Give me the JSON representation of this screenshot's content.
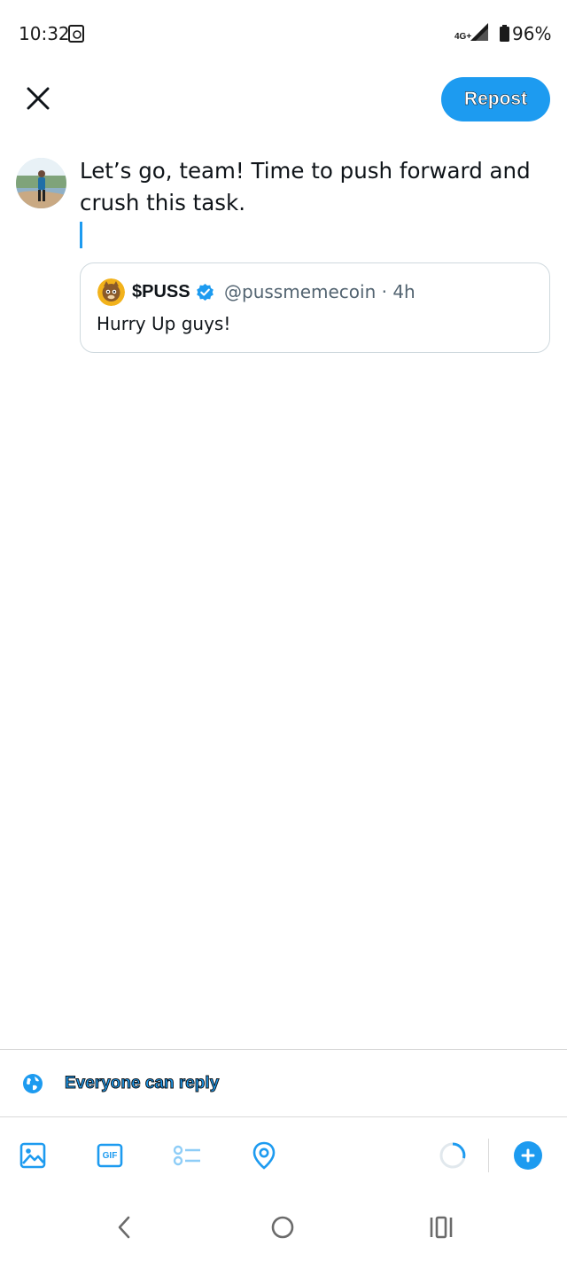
{
  "status_bar": {
    "time": "10:32",
    "network": "4G+",
    "battery": "96%"
  },
  "header": {
    "close_icon": "close-icon",
    "repost_label": "Repost"
  },
  "compose": {
    "avatar": "user-avatar",
    "text": "Let’s go, team! Time to push forward and crush this task."
  },
  "quote": {
    "avatar": "puss-avatar",
    "name": "$PUSS",
    "verified": "verified-badge-icon",
    "handle": "@pussmemecoin",
    "separator": "·",
    "time": "4h",
    "body": "Hurry Up guys!"
  },
  "reply_setting": {
    "icon": "globe-icon",
    "label": "Everyone can reply"
  },
  "toolbar": {
    "tools": [
      "image-icon",
      "gif-icon",
      "poll-icon",
      "location-icon"
    ],
    "gif_label": "GIF",
    "progress_icon": "character-count-ring",
    "add_icon": "add-icon"
  },
  "nav": [
    "back-icon",
    "home-icon",
    "recents-icon"
  ],
  "colors": {
    "accent": "#1d9bf0",
    "text": "#0f1419",
    "secondary": "#536471",
    "border": "#cfd9de"
  }
}
